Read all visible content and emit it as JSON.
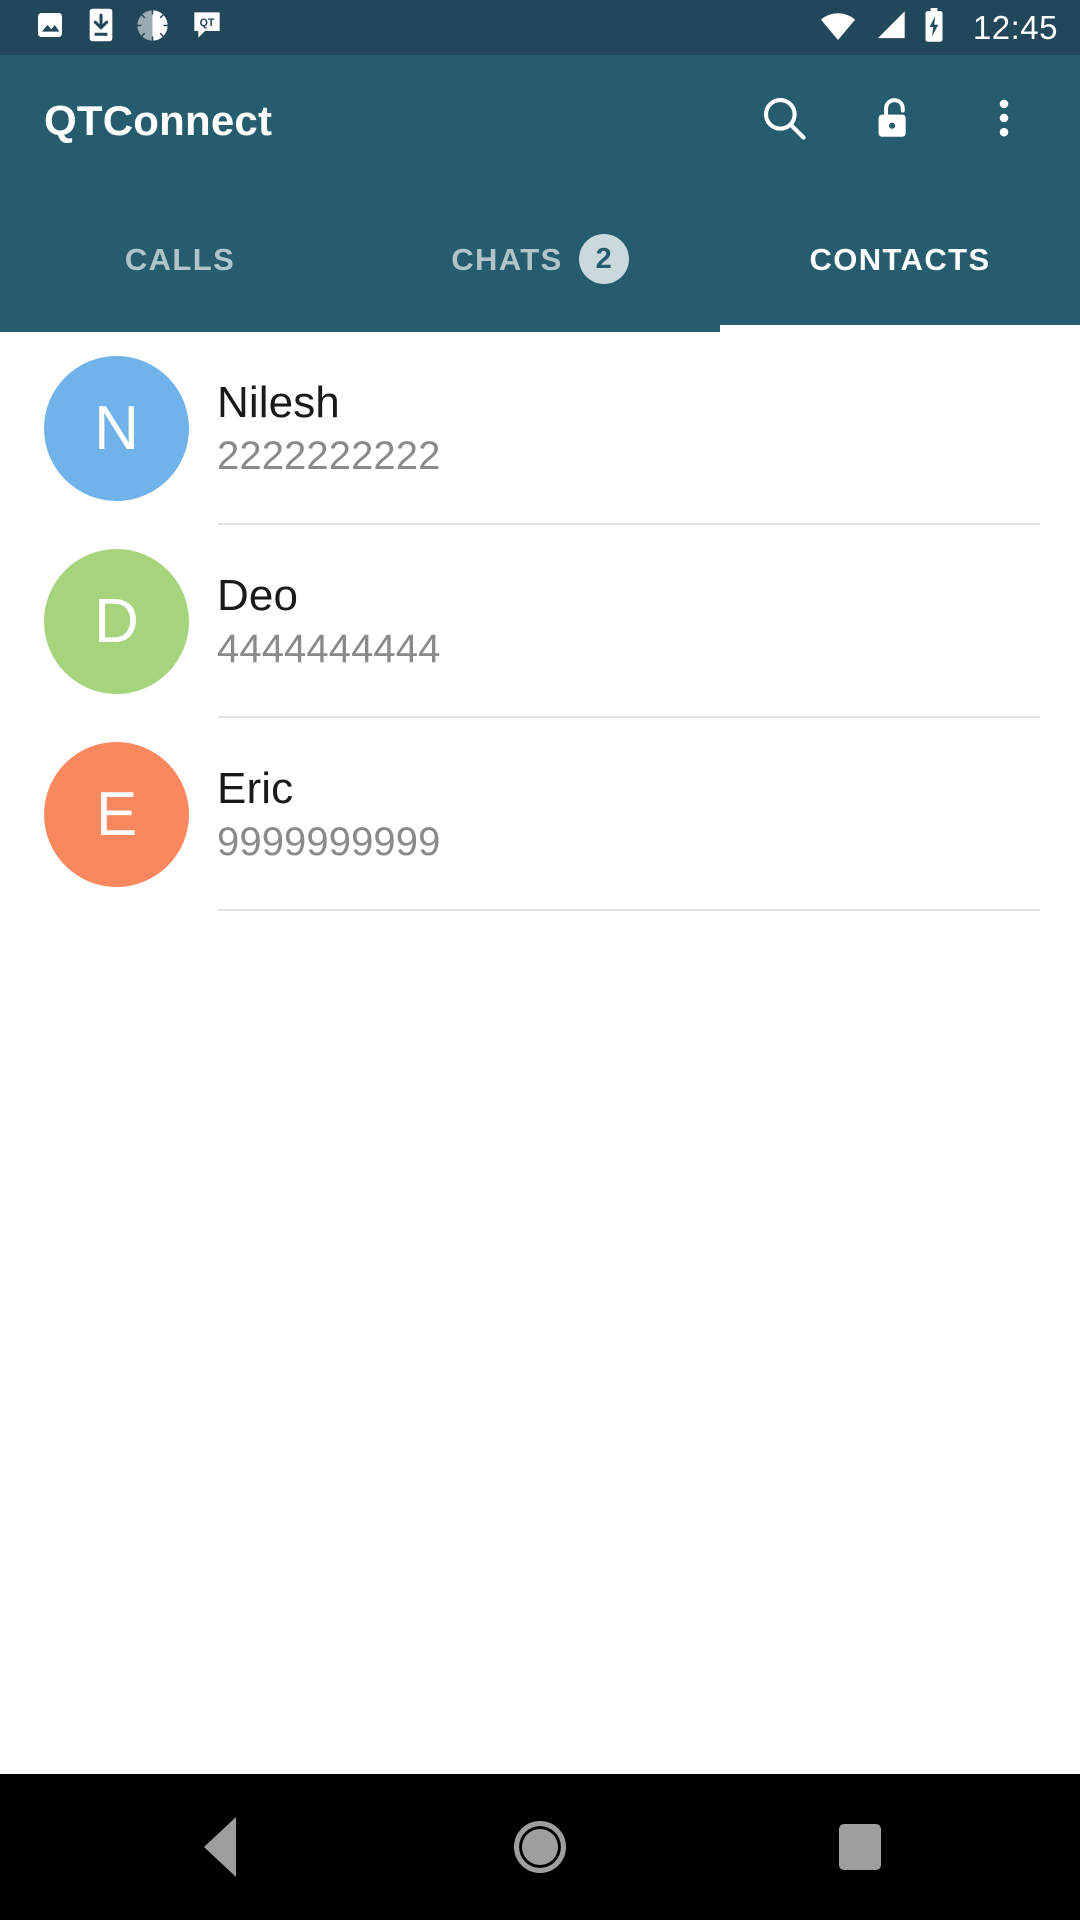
{
  "status_bar": {
    "icons": [
      "image-icon",
      "download-to-device-icon",
      "sync-spinner-icon",
      "qt-chat-bubble-icon"
    ],
    "wifi": "wifi-icon",
    "signal": "cellular-signal-icon",
    "battery": "battery-charging-icon",
    "time": "12:45",
    "background": "#22465A"
  },
  "app_bar": {
    "title": "QTConnect",
    "background": "#255C6E",
    "actions": [
      {
        "name": "search-icon",
        "label": "Search"
      },
      {
        "name": "unlock-icon",
        "label": "Unlock"
      },
      {
        "name": "overflow-menu-icon",
        "label": "More options"
      }
    ]
  },
  "tabs": {
    "active_index": 2,
    "indicator_color": "#FFFFFF",
    "items": [
      {
        "label": "CALLS",
        "badge": ""
      },
      {
        "label": "CHATS",
        "badge": "2"
      },
      {
        "label": "CONTACTS",
        "badge": ""
      }
    ]
  },
  "contacts": {
    "items": [
      {
        "initial": "N",
        "name": "Nilesh",
        "number": "2222222222",
        "color": "#6FB3EA"
      },
      {
        "initial": "D",
        "name": "Deo",
        "number": "4444444444",
        "color": "#A5D47D"
      },
      {
        "initial": "E",
        "name": "Eric",
        "number": "9999999999",
        "color": "#F9885F"
      }
    ]
  },
  "nav_bar": {
    "background": "#000000",
    "buttons": [
      {
        "name": "back-button",
        "label": "Back"
      },
      {
        "name": "home-button",
        "label": "Home"
      },
      {
        "name": "recents-button",
        "label": "Recents"
      }
    ]
  }
}
